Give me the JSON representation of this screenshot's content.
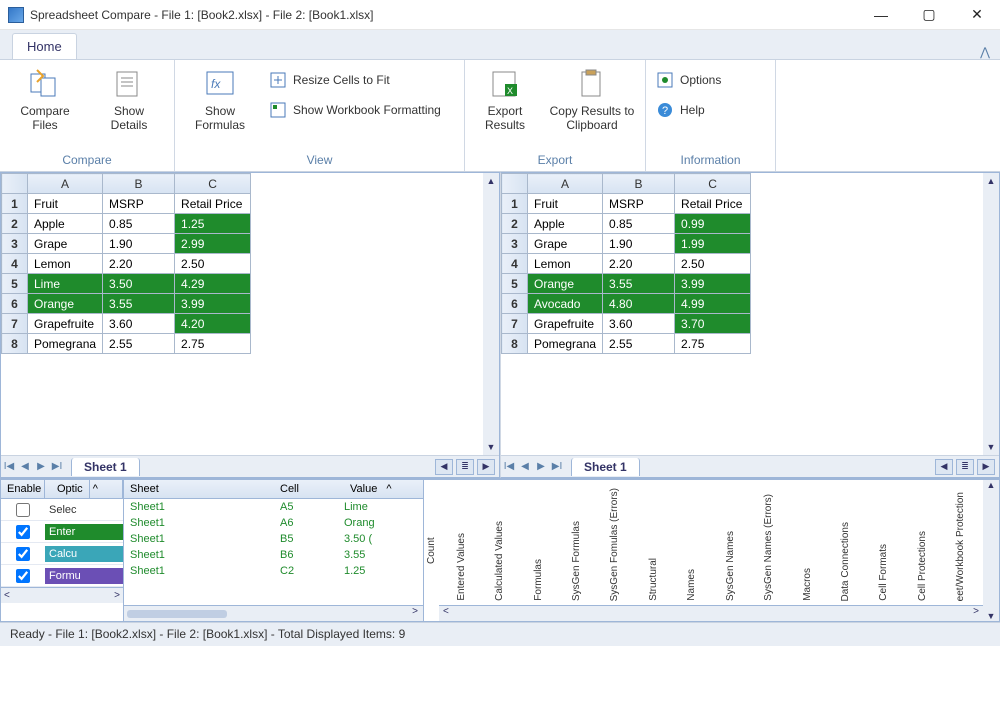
{
  "window": {
    "title": "Spreadsheet Compare - File 1: [Book2.xlsx] - File 2: [Book1.xlsx]"
  },
  "tab": {
    "home": "Home"
  },
  "ribbon": {
    "compare": {
      "compareFiles": "Compare Files",
      "showDetails": "Show Details",
      "label": "Compare"
    },
    "view": {
      "showFormulas": "Show Formulas",
      "resize": "Resize Cells to Fit",
      "showFormatting": "Show Workbook Formatting",
      "label": "View"
    },
    "export": {
      "exportResults": "Export Results",
      "copyClipboard": "Copy Results to Clipboard",
      "label": "Export"
    },
    "info": {
      "options": "Options",
      "help": "Help",
      "label": "Information"
    }
  },
  "sheetTab": "Sheet 1",
  "grid1": {
    "headers": [
      "A",
      "B",
      "C"
    ],
    "rows": [
      {
        "n": "1",
        "a": "Fruit",
        "b": "MSRP",
        "c": "Retail Price",
        "da": false,
        "db": false,
        "dc": false
      },
      {
        "n": "2",
        "a": "Apple",
        "b": "0.85",
        "c": "1.25",
        "da": false,
        "db": false,
        "dc": true
      },
      {
        "n": "3",
        "a": "Grape",
        "b": "1.90",
        "c": "2.99",
        "da": false,
        "db": false,
        "dc": true
      },
      {
        "n": "4",
        "a": "Lemon",
        "b": "2.20",
        "c": "2.50",
        "da": false,
        "db": false,
        "dc": false
      },
      {
        "n": "5",
        "a": "Lime",
        "b": "3.50",
        "c": "4.29",
        "da": true,
        "db": true,
        "dc": true
      },
      {
        "n": "6",
        "a": "Orange",
        "b": "3.55",
        "c": "3.99",
        "da": true,
        "db": true,
        "dc": true
      },
      {
        "n": "7",
        "a": "Grapefruite",
        "b": "3.60",
        "c": "4.20",
        "da": false,
        "db": false,
        "dc": true
      },
      {
        "n": "8",
        "a": "Pomegrana",
        "b": "2.55",
        "c": "2.75",
        "da": false,
        "db": false,
        "dc": false
      }
    ]
  },
  "grid2": {
    "headers": [
      "A",
      "B",
      "C"
    ],
    "rows": [
      {
        "n": "1",
        "a": "Fruit",
        "b": "MSRP",
        "c": "Retail Price",
        "da": false,
        "db": false,
        "dc": false
      },
      {
        "n": "2",
        "a": "Apple",
        "b": "0.85",
        "c": "0.99",
        "da": false,
        "db": false,
        "dc": true
      },
      {
        "n": "3",
        "a": "Grape",
        "b": "1.90",
        "c": "1.99",
        "da": false,
        "db": false,
        "dc": true
      },
      {
        "n": "4",
        "a": "Lemon",
        "b": "2.20",
        "c": "2.50",
        "da": false,
        "db": false,
        "dc": false
      },
      {
        "n": "5",
        "a": "Orange",
        "b": "3.55",
        "c": "3.99",
        "da": true,
        "db": true,
        "dc": true
      },
      {
        "n": "6",
        "a": "Avocado",
        "b": "4.80",
        "c": "4.99",
        "da": true,
        "db": true,
        "dc": true
      },
      {
        "n": "7",
        "a": "Grapefruite",
        "b": "3.60",
        "c": "3.70",
        "da": false,
        "db": false,
        "dc": true
      },
      {
        "n": "8",
        "a": "Pomegrana",
        "b": "2.55",
        "c": "2.75",
        "da": false,
        "db": false,
        "dc": false
      }
    ]
  },
  "options": {
    "hdrEnable": "Enable",
    "hdrOption": "Optic",
    "rows": [
      {
        "chk": false,
        "label": "Selec",
        "color": "#ffffff",
        "text": "#333"
      },
      {
        "chk": true,
        "label": "Enter",
        "color": "#1f8b2c",
        "text": "#fff"
      },
      {
        "chk": true,
        "label": "Calcu",
        "color": "#3aa6b8",
        "text": "#fff"
      },
      {
        "chk": true,
        "label": "Formu",
        "color": "#6b4fb5",
        "text": "#fff"
      }
    ]
  },
  "results": {
    "hdrSheet": "Sheet",
    "hdrCell": "Cell",
    "hdrValue": "Value",
    "rows": [
      {
        "sheet": "Sheet1",
        "cell": "A5",
        "value": "Lime"
      },
      {
        "sheet": "Sheet1",
        "cell": "A6",
        "value": "Orang"
      },
      {
        "sheet": "Sheet1",
        "cell": "B5",
        "value": "3.50 ("
      },
      {
        "sheet": "Sheet1",
        "cell": "B6",
        "value": "3.55"
      },
      {
        "sheet": "Sheet1",
        "cell": "C2",
        "value": "1.25"
      }
    ]
  },
  "chart": {
    "ylabel": "Count",
    "categories": [
      "Entered Values",
      "Calculated Values",
      "Formulas",
      "SysGen Formulas",
      "SysGen Fomulas (Errors)",
      "Structural",
      "Names",
      "SysGen Names",
      "SysGen Names (Errors)",
      "Macros",
      "Data Connections",
      "Cell Formats",
      "Cell Protections",
      "eet/Workbook Protection"
    ]
  },
  "status": "Ready - File 1: [Book2.xlsx] - File 2: [Book1.xlsx] - Total Displayed Items: 9",
  "chart_data": {
    "type": "bar",
    "categories": [
      "Entered Values",
      "Calculated Values",
      "Formulas",
      "SysGen Formulas",
      "SysGen Fomulas (Errors)",
      "Structural",
      "Names",
      "SysGen Names",
      "SysGen Names (Errors)",
      "Macros",
      "Data Connections",
      "Cell Formats",
      "Cell Protections",
      "Sheet/Workbook Protection"
    ],
    "values": [
      0,
      0,
      0,
      0,
      0,
      0,
      0,
      0,
      0,
      0,
      0,
      0,
      0,
      0
    ],
    "ylabel": "Count"
  }
}
